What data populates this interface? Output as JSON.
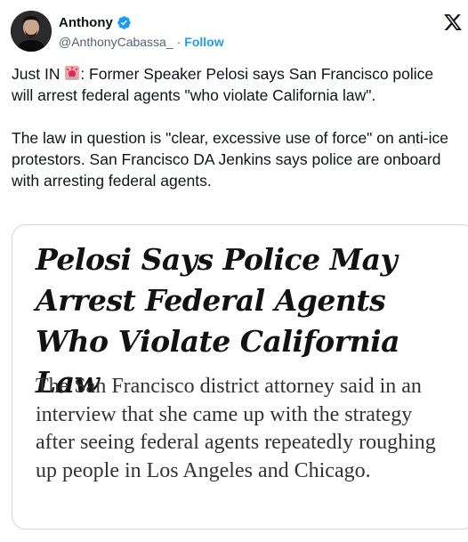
{
  "author": {
    "display_name": "Anthony",
    "handle": "@AnthonyCabassa_",
    "separator": "·",
    "follow_label": "Follow",
    "verified_color": "#1d9bf0"
  },
  "platform_logo": "x-logo-icon",
  "tweet": {
    "prefix": "Just IN ",
    "emoji": "police-siren-emoji",
    "line1_rest": ": Former Speaker Pelosi says San Francisco police will arrest federal agents \"who violate California law\".",
    "paragraph2": "The law in question is \"clear, excessive use of force\" on anti-ice protestors. San Francisco DA Jenkins says police are onboard with arresting federal agents."
  },
  "card": {
    "headline": "Pelosi Says Police May Arrest Federal Agents Who Violate California Law",
    "summary": "The San Francisco district attorney said in an interview that she came up with the strategy after seeing federal agents repeatedly roughing up people in Los Angeles and Chicago."
  },
  "colors": {
    "link": "#1d9bf0",
    "text": "#0f1419",
    "muted": "#536471",
    "border": "#cfd9de"
  }
}
